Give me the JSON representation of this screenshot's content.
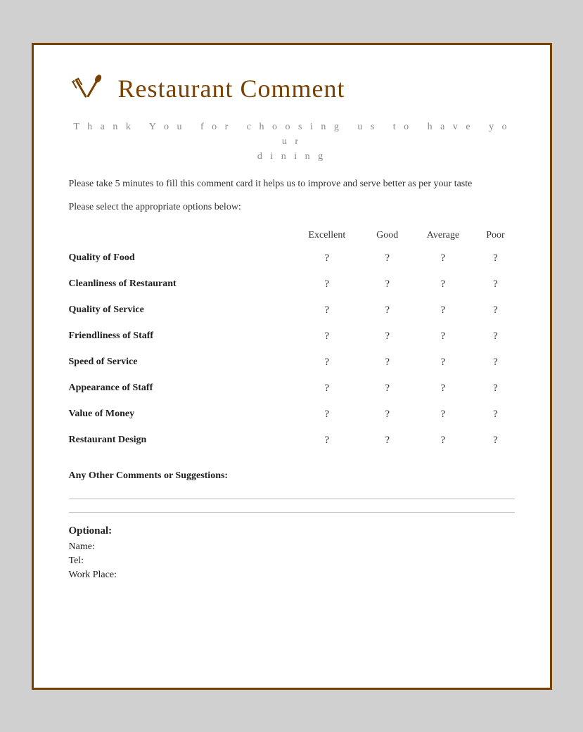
{
  "header": {
    "title": "Restaurant Comment"
  },
  "thank_you": "T h a n k  Y o u  f o r  c h o o s i n g  u s  t o  h a v e  y o u r\nd i n n i n g",
  "intro": "Please take 5 minutes to fill this comment card it helps us to improve and serve better as per your taste",
  "select_prompt": "Please select the appropriate options below:",
  "table": {
    "columns": [
      "",
      "Excellent",
      "Good",
      "Average",
      "Poor"
    ],
    "rows": [
      {
        "label": "Quality of Food"
      },
      {
        "label": "Cleanliness of Restaurant"
      },
      {
        "label": "Quality of Service"
      },
      {
        "label": "Friendliness of Staff"
      },
      {
        "label": "Speed of Service"
      },
      {
        "label": "Appearance of Staff"
      },
      {
        "label": "Value of Money"
      },
      {
        "label": "Restaurant Design"
      }
    ],
    "cell_value": "?"
  },
  "comments_label": "Any Other Comments or Suggestions:",
  "optional": {
    "title": "Optional:",
    "fields": [
      "Name:",
      "Tel:",
      "Work Place:"
    ]
  }
}
